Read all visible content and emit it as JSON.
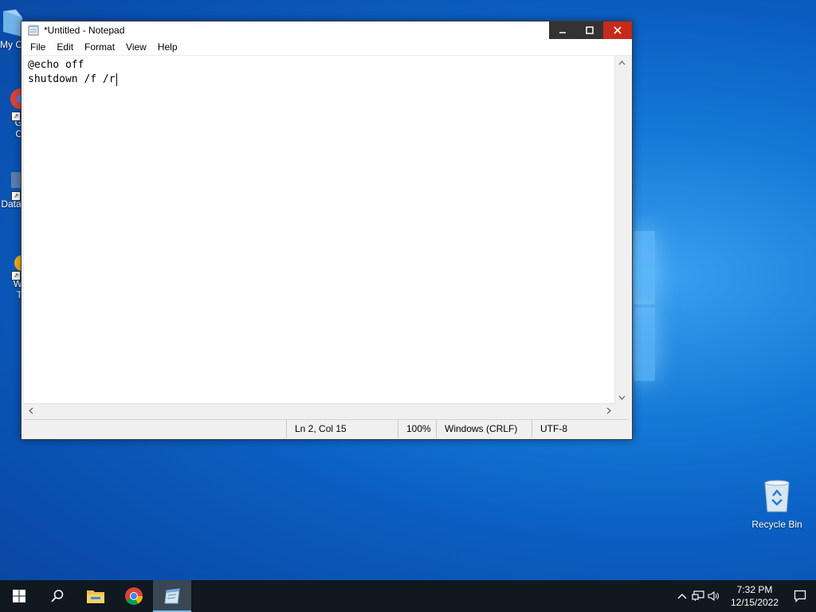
{
  "desktop": {
    "left_icons": [
      {
        "label": "My C",
        "icon": "folder-icon"
      },
      {
        "label": "G\nC",
        "icon": "chrome-icon"
      },
      {
        "label": "Data",
        "icon": "database-icon"
      },
      {
        "label": "W\nT",
        "icon": "app-icon"
      }
    ],
    "recycle_bin": {
      "label": "Recycle Bin",
      "icon": "recycle-bin-icon"
    }
  },
  "notepad": {
    "title": "*Untitled - Notepad",
    "menu": [
      "File",
      "Edit",
      "Format",
      "View",
      "Help"
    ],
    "content_lines": [
      "@echo off",
      "shutdown /f /r"
    ],
    "status": {
      "position": "Ln 2, Col 15",
      "zoom": "100%",
      "line_endings": "Windows (CRLF)",
      "encoding": "UTF-8"
    }
  },
  "taskbar": {
    "pinned": [
      "start-icon",
      "search-icon",
      "file-explorer-icon",
      "chrome-icon",
      "notepad-icon"
    ],
    "active": "notepad-icon",
    "clock": {
      "time": "7:32 PM",
      "date": "12/15/2022"
    }
  },
  "colors": {
    "close_red": "#c42b1c",
    "taskbar": "#101820",
    "accent": "#76b9ed"
  }
}
